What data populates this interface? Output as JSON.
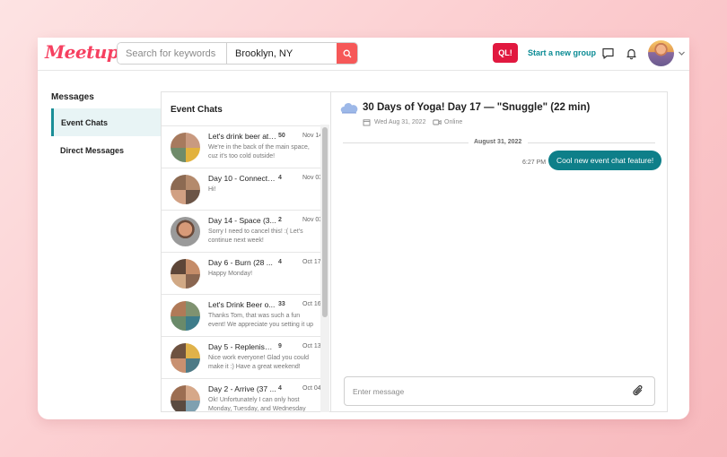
{
  "brand": {
    "logo_text": "Meetup",
    "color": "#f64060"
  },
  "header": {
    "search_placeholder": "Search for keywords",
    "location_value": "Brooklyn, NY",
    "ql_label": "QL!",
    "start_group_label": "Start a new group",
    "icons": [
      "search-icon",
      "chat-icon",
      "bell-icon",
      "chevron-down-icon"
    ]
  },
  "sidebar": {
    "title": "Messages",
    "items": [
      {
        "label": "Event Chats",
        "active": true
      },
      {
        "label": "Direct Messages",
        "active": false
      }
    ]
  },
  "chats": {
    "title": "Event Chats",
    "items": [
      {
        "name": "Let's drink beer at ...",
        "count": "50",
        "date": "Nov 14",
        "preview": "We're in the back of the main space, cuz it's too cold outside!"
      },
      {
        "name": "Day 10 - Connect (...",
        "count": "4",
        "date": "Nov 03",
        "preview": "Hi!"
      },
      {
        "name": "Day 14 - Space (3...",
        "count": "2",
        "date": "Nov 03",
        "preview": "Sorry I need to cancel this! :( Let's continue next week!"
      },
      {
        "name": "Day 6 - Burn (28 ...",
        "count": "4",
        "date": "Oct 17",
        "preview": "Happy Monday!"
      },
      {
        "name": "Let's Drink Beer o...",
        "count": "33",
        "date": "Oct 16",
        "preview": "Thanks Tom, that was such a fun event! We appreciate you setting it up"
      },
      {
        "name": "Day 5 - Replenish ...",
        "count": "9",
        "date": "Oct 13",
        "preview": "Nice work everyone! Glad you could make it :) Have a great weekend!"
      },
      {
        "name": "Day 2 - Arrive (37 ...",
        "count": "4",
        "date": "Oct 04",
        "preview": "Ok! Unfortunately I can only host Monday, Tuesday, and Wednesday"
      }
    ]
  },
  "conversation": {
    "title": "30 Days of Yoga! Day 17 — \"Snuggle\" (22 min)",
    "date": "Wed Aug 31, 2022",
    "location": "Online",
    "divider_date": "August 31, 2022",
    "message": {
      "time": "6:27 PM",
      "text": "Cool new event chat feature!"
    },
    "input_placeholder": "Enter message",
    "accent": "#0e7f89"
  }
}
